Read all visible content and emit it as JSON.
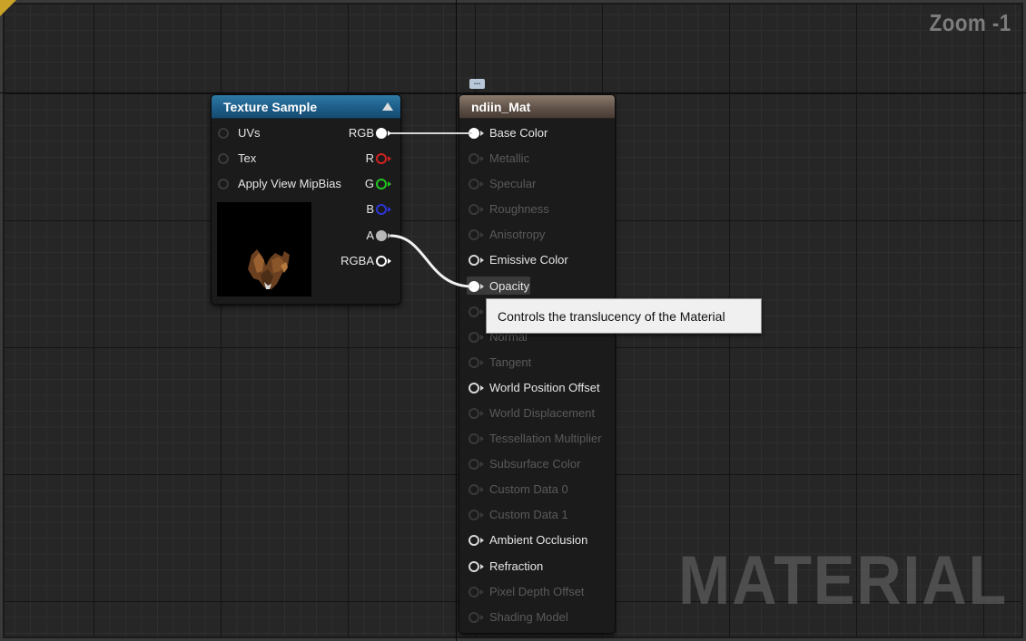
{
  "zoom_label": "Zoom -1",
  "watermark": "MATERIAL",
  "texture_node": {
    "title": "Texture Sample",
    "inputs": [
      {
        "label": "UVs"
      },
      {
        "label": "Tex"
      },
      {
        "label": "Apply View MipBias"
      }
    ],
    "outputs": [
      {
        "label": "RGB",
        "color": "#ffffff",
        "connected": true
      },
      {
        "label": "R",
        "color": "#d42020",
        "connected": false
      },
      {
        "label": "G",
        "color": "#22c522",
        "connected": false
      },
      {
        "label": "B",
        "color": "#2b35d8",
        "connected": false
      },
      {
        "label": "A",
        "color": "#b8b8b8",
        "connected": true
      },
      {
        "label": "RGBA",
        "color": "#ffffff",
        "connected": false
      }
    ]
  },
  "material_node": {
    "title": "ndiin_Mat",
    "inputs": [
      {
        "label": "Base Color",
        "enabled": true,
        "connected": true
      },
      {
        "label": "Metallic",
        "enabled": false
      },
      {
        "label": "Specular",
        "enabled": false
      },
      {
        "label": "Roughness",
        "enabled": false
      },
      {
        "label": "Anisotropy",
        "enabled": false
      },
      {
        "label": "Emissive Color",
        "enabled": true
      },
      {
        "label": "Opacity",
        "enabled": true,
        "connected": true
      },
      {
        "label": "",
        "enabled": false
      },
      {
        "label": "Normal",
        "enabled": false
      },
      {
        "label": "Tangent",
        "enabled": false
      },
      {
        "label": "World Position Offset",
        "enabled": true
      },
      {
        "label": "World Displacement",
        "enabled": false
      },
      {
        "label": "Tessellation Multiplier",
        "enabled": false
      },
      {
        "label": "Subsurface Color",
        "enabled": false
      },
      {
        "label": "Custom Data 0",
        "enabled": false
      },
      {
        "label": "Custom Data 1",
        "enabled": false
      },
      {
        "label": "Ambient Occlusion",
        "enabled": true
      },
      {
        "label": "Refraction",
        "enabled": true
      },
      {
        "label": "Pixel Depth Offset",
        "enabled": false
      },
      {
        "label": "Shading Model",
        "enabled": false
      }
    ]
  },
  "tooltip": "Controls the translucency of the Material",
  "colors": {
    "texture_header": "#1f5f8c",
    "material_header": "#6e6054",
    "accent_corner": "#c9a227"
  }
}
